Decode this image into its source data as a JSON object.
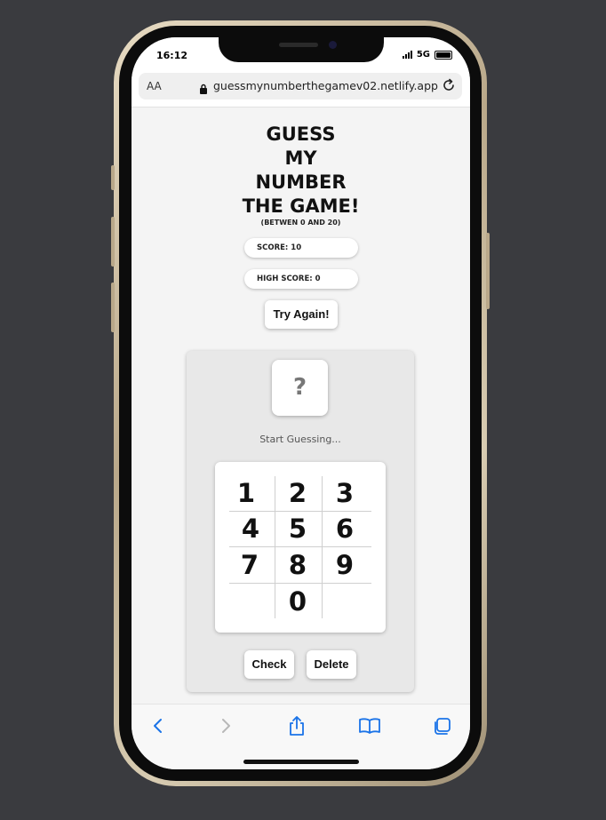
{
  "status": {
    "time": "16:12",
    "network": "5G"
  },
  "browser": {
    "aa_label": "AA",
    "url": "guessmynumberthegamev02.netlify.app"
  },
  "game": {
    "title_lines": [
      "GUESS",
      "MY",
      "NUMBER",
      "THE GAME!"
    ],
    "subtitle": "(BETWEN 0 AND 20)",
    "score_label": "SCORE: 10",
    "highscore_label": "HIGH SCORE: 0",
    "try_again_label": "Try Again!",
    "secret_display": "?",
    "message": "Start Guessing...",
    "keys": [
      "1",
      "2",
      "3",
      "4",
      "5",
      "6",
      "7",
      "8",
      "9",
      "0"
    ],
    "check_label": "Check",
    "delete_label": "Delete"
  },
  "toolbar": {
    "icons": [
      "back-icon",
      "forward-icon",
      "share-icon",
      "bookmarks-icon",
      "tabs-icon"
    ],
    "accent_color": "#1a73e8"
  }
}
